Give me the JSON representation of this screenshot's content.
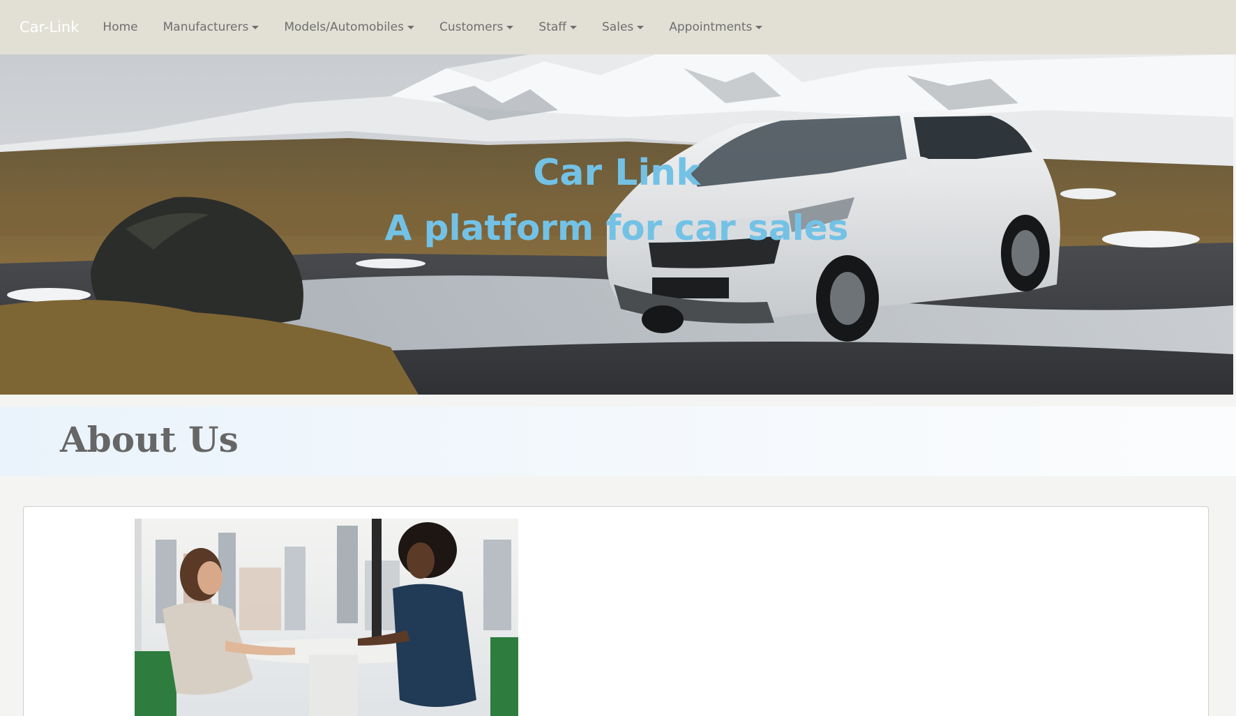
{
  "navbar": {
    "brand": "Car-Link",
    "items": [
      {
        "label": "Home",
        "dropdown": false
      },
      {
        "label": "Manufacturers",
        "dropdown": true
      },
      {
        "label": "Models/Automobiles",
        "dropdown": true
      },
      {
        "label": "Customers",
        "dropdown": true
      },
      {
        "label": "Staff",
        "dropdown": true
      },
      {
        "label": "Sales",
        "dropdown": true
      },
      {
        "label": "Appointments",
        "dropdown": true
      }
    ]
  },
  "hero": {
    "title": "Car Link",
    "subtitle": "A platform for car sales"
  },
  "about": {
    "heading": "About Us"
  },
  "colors": {
    "navbar_bg": "#e2e0d5",
    "accent": "#73c2e6",
    "nav_text": "#6e6e6e"
  }
}
